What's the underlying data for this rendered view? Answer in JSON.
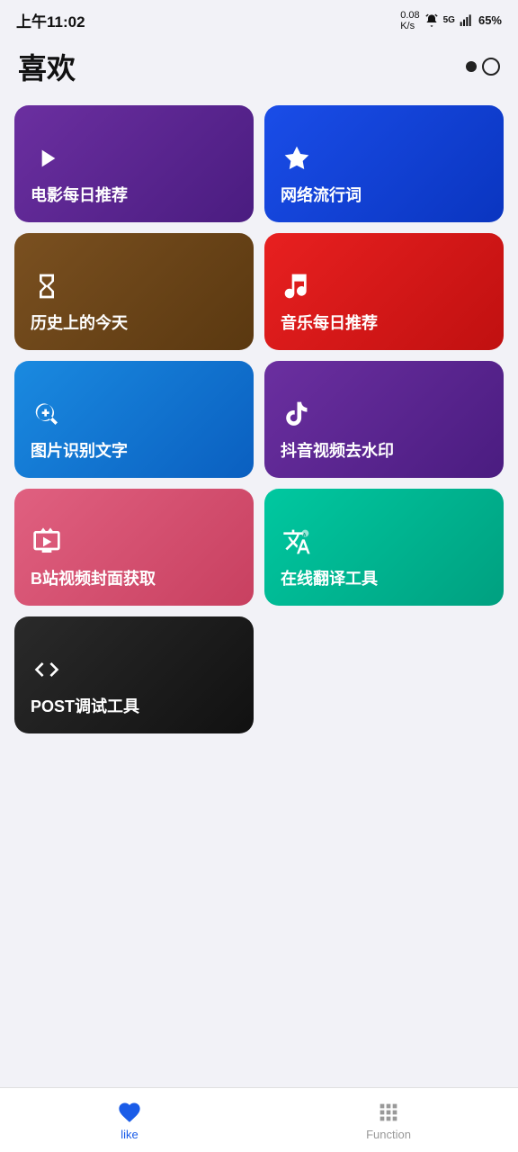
{
  "statusBar": {
    "time": "上午11:02",
    "netSpeed": "0.08\nK/s",
    "battery": "65%"
  },
  "header": {
    "title": "喜欢"
  },
  "cards": [
    {
      "id": "card-movie",
      "label": "电影每日推荐",
      "colorClass": "card-purple",
      "icon": "play"
    },
    {
      "id": "card-trending",
      "label": "网络流行词",
      "colorClass": "card-blue",
      "icon": "star"
    },
    {
      "id": "card-history",
      "label": "历史上的今天",
      "colorClass": "card-brown",
      "icon": "hourglass"
    },
    {
      "id": "card-music",
      "label": "音乐每日推荐",
      "colorClass": "card-red",
      "icon": "music"
    },
    {
      "id": "card-ocr",
      "label": "图片识别文字",
      "colorClass": "card-blue2",
      "icon": "search-image"
    },
    {
      "id": "card-douyin",
      "label": "抖音视频去水印",
      "colorClass": "card-purple2",
      "icon": "tiktok"
    },
    {
      "id": "card-bilibili",
      "label": "B站视频封面获取",
      "colorClass": "card-pink",
      "icon": "tv"
    },
    {
      "id": "card-translate",
      "label": "在线翻译工具",
      "colorClass": "card-teal",
      "icon": "translate"
    },
    {
      "id": "card-post",
      "label": "POST调试工具",
      "colorClass": "card-dark",
      "icon": "code"
    }
  ],
  "bottomNav": {
    "likeLabel": "like",
    "functionLabel": "Function"
  }
}
